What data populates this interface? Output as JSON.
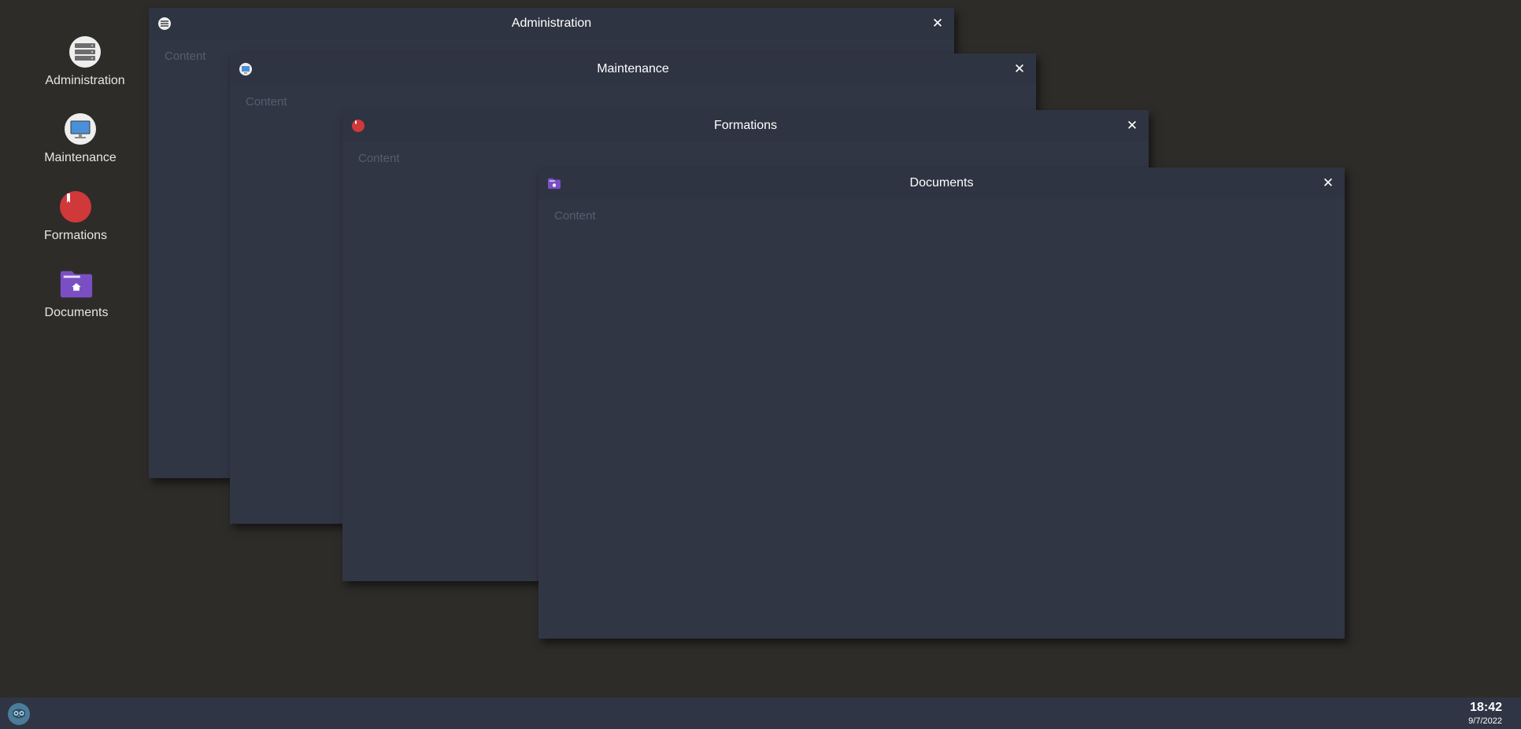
{
  "desktop_icons": [
    {
      "label": "Administration",
      "icon": "server-icon"
    },
    {
      "label": "Maintenance",
      "icon": "monitor-icon"
    },
    {
      "label": "Formations",
      "icon": "bookmark-icon"
    },
    {
      "label": "Documents",
      "icon": "folder-home-icon"
    }
  ],
  "windows": [
    {
      "title": "Administration",
      "content": "Content",
      "icon": "server-icon"
    },
    {
      "title": "Maintenance",
      "content": "Content",
      "icon": "monitor-icon"
    },
    {
      "title": "Formations",
      "content": "Content",
      "icon": "bookmark-icon"
    },
    {
      "title": "Documents",
      "content": "Content",
      "icon": "folder-home-icon"
    }
  ],
  "close_glyph": "✕",
  "taskbar": {
    "start_icon": "owl-icon",
    "time": "18:42",
    "date": "9/7/2022"
  },
  "colors": {
    "desktop": "#2e2c29",
    "window": "#313645",
    "taskbar": "#2f3544",
    "formations_red": "#d0383a",
    "documents_purple": "#7b4fc4",
    "monitor_blue": "#4a90d9"
  }
}
